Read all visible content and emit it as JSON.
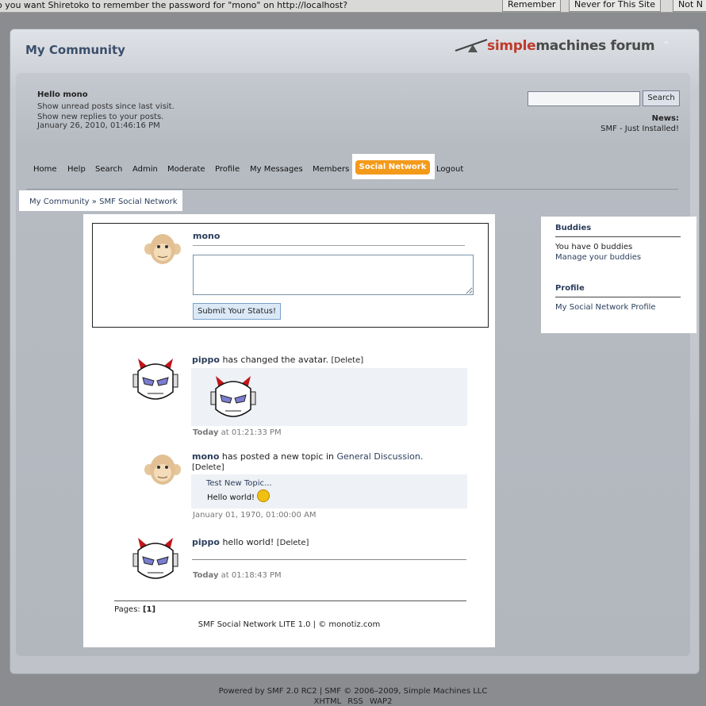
{
  "password_bar": {
    "message": "o you want Shiretoko to remember the password for \"mono\" on http://localhost?",
    "remember": "Remember",
    "never": "Never for This Site",
    "not_now": "Not N"
  },
  "header": {
    "site_title": "My Community",
    "logo_simple": "simple",
    "logo_machines": "machines forum",
    "collapse_icon": "chevron-up-icon"
  },
  "user": {
    "greeting": "Hello mono",
    "unread": "Show unread posts since last visit.",
    "replies": "Show new replies to your posts.",
    "date": "January 26, 2010, 01:46:16 PM"
  },
  "search": {
    "button": "Search",
    "value": ""
  },
  "news": {
    "label": "News:",
    "text": "SMF - Just Installed!"
  },
  "menu": {
    "items": [
      "Home",
      "Help",
      "Search",
      "Admin",
      "Moderate",
      "Profile",
      "My Messages",
      "Members"
    ],
    "active": "Social Network",
    "logout": "Logout"
  },
  "breadcrumb": {
    "home": "My Community",
    "sep": " » ",
    "current": "SMF Social Network"
  },
  "status": {
    "name": "mono",
    "textarea_value": "",
    "submit": "Submit Your Status!"
  },
  "feed": [
    {
      "user": "pippo",
      "action": "has changed the avatar.",
      "delete": "[Delete]",
      "time_bold": "Today",
      "time_rest": "at 01:21:33 PM",
      "avatar": "devil"
    },
    {
      "user": "mono",
      "action": "has posted a new topic in",
      "link": "General Discussion.",
      "delete": "[Delete]",
      "post_title": "Test New Topic...",
      "post_body": "Hello world!",
      "time": "January 01, 1970, 01:00:00 AM",
      "avatar": "monkey"
    },
    {
      "user": "pippo",
      "action": "hello world!",
      "delete": "[Delete]",
      "time_bold": "Today",
      "time_rest": "at 01:18:43 PM",
      "avatar": "devil"
    }
  ],
  "pages": {
    "label": "Pages:",
    "current": "[1]"
  },
  "footer_note": "SMF Social Network LITE 1.0 | © monotiz.com",
  "sidebar": {
    "buddies_title": "Buddies",
    "buddies_count": "You have 0 buddies",
    "manage": "Manage your buddies",
    "profile_title": "Profile",
    "profile_link": "My Social Network Profile"
  },
  "powered": {
    "line": "Powered by SMF 2.0 RC2 | SMF © 2006–2009, Simple Machines LLC",
    "links": [
      "XHTML",
      "RSS",
      "WAP2"
    ]
  }
}
